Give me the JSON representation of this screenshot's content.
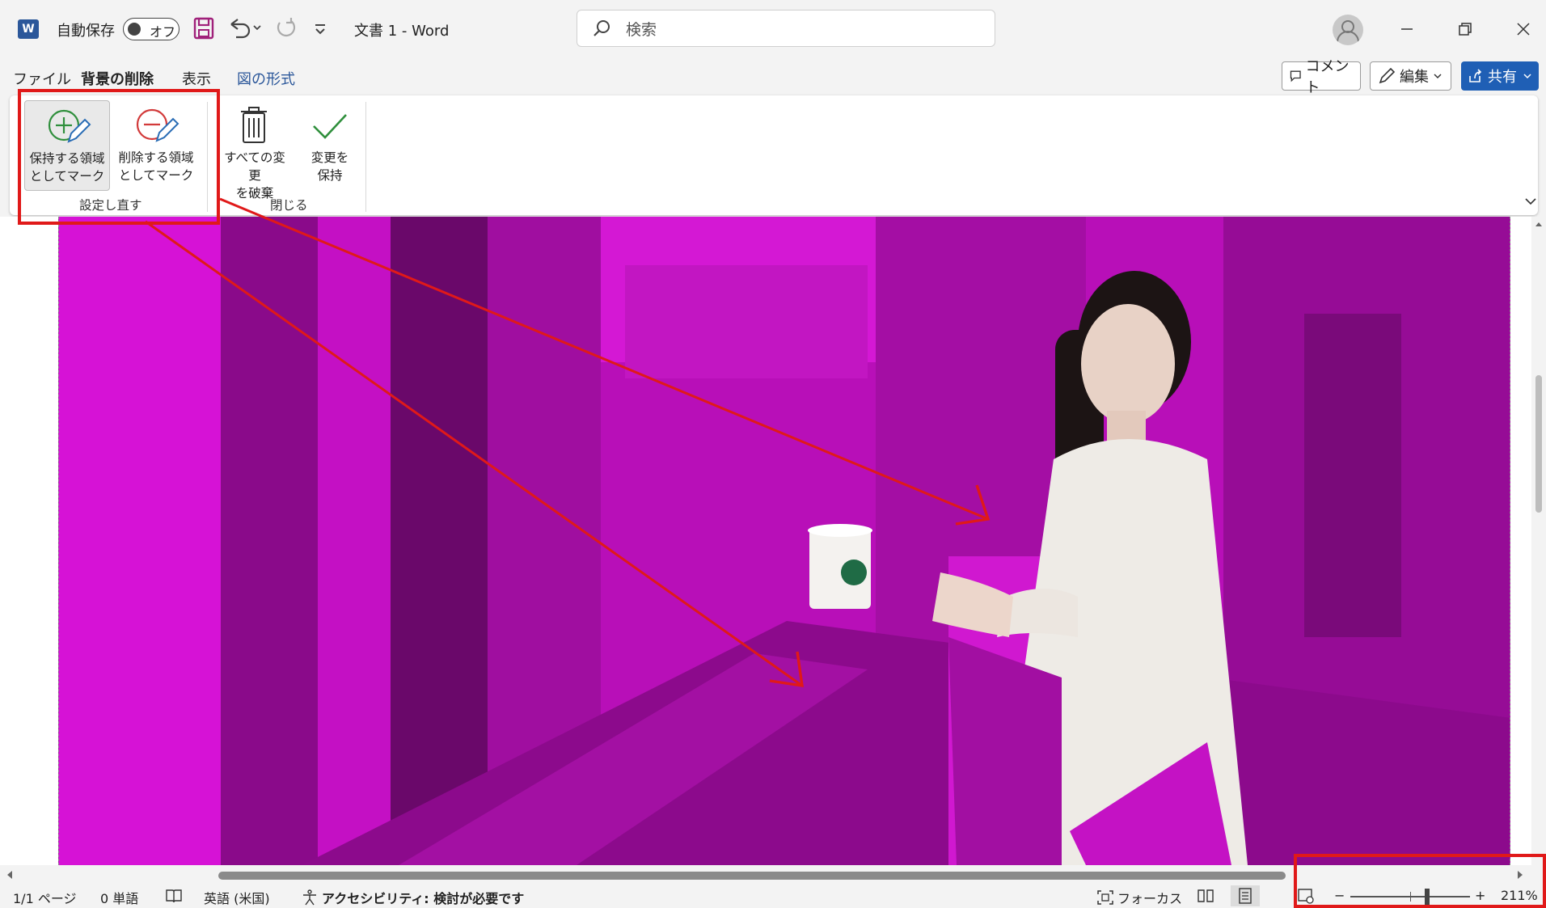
{
  "titlebar": {
    "app_logo": "W",
    "autosave_label": "自動保存",
    "autosave_state": "オフ",
    "doc_title": "文書 1  -  Word",
    "search_placeholder": "検索"
  },
  "tabs": [
    {
      "label": "ファイル"
    },
    {
      "label": "背景の削除"
    },
    {
      "label": "表示"
    },
    {
      "label": "図の形式"
    }
  ],
  "header_buttons": {
    "comment": "コメント",
    "edit": "編集",
    "share": "共有"
  },
  "ribbon": {
    "mark_keep": [
      "保持する領域",
      "としてマーク"
    ],
    "mark_remove": [
      "削除する領域",
      "としてマーク"
    ],
    "group_refine": "設定し直す",
    "discard": [
      "すべての変更",
      "を破棄"
    ],
    "keep_changes": [
      "変更を",
      "保持"
    ],
    "group_close": "閉じる"
  },
  "statusbar": {
    "page": "1/1 ページ",
    "words": "0 単語",
    "language": "英語 (米国)",
    "accessibility": "アクセシビリティ: 検討が必要です",
    "focus": "フォーカス",
    "zoom_minus": "−",
    "zoom_plus": "+",
    "zoom": "211%"
  },
  "colors": {
    "accent": "#2b579a",
    "share": "#1f5fb5",
    "highlight": "#e01919",
    "removal_overlay": "#b60fb6"
  }
}
